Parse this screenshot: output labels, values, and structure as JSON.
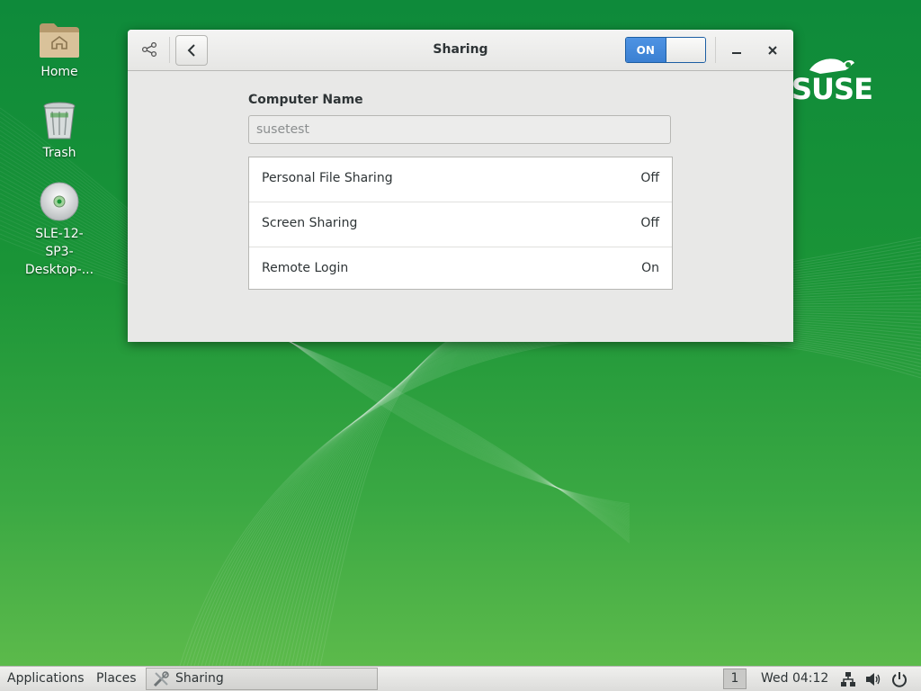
{
  "desktop": {
    "brand": "SUSE",
    "icons": [
      {
        "label": "Home",
        "icon": "home-folder-icon"
      },
      {
        "label": "Trash",
        "icon": "trash-icon"
      },
      {
        "label": "SLE-12-SP3-Desktop-...",
        "label_lines": [
          "SLE-12-",
          "SP3-",
          "Desktop-..."
        ],
        "icon": "optical-disc-icon"
      }
    ]
  },
  "window": {
    "title": "Sharing",
    "master_switch": "ON",
    "header_icon": "share-icon",
    "back_icon": "chevron-left-icon",
    "minimize_icon": "minimize-icon",
    "close_icon": "close-icon",
    "computer_name_label": "Computer Name",
    "computer_name_value": "susetest",
    "services": [
      {
        "name": "Personal File Sharing",
        "status": "Off"
      },
      {
        "name": "Screen Sharing",
        "status": "Off"
      },
      {
        "name": "Remote Login",
        "status": "On"
      }
    ]
  },
  "taskbar": {
    "applications": "Applications",
    "places": "Places",
    "task": {
      "label": "Sharing",
      "icon": "settings-tools-icon"
    },
    "workspace": "1",
    "clock": "Wed 04:12",
    "tray": [
      "network-icon",
      "volume-icon",
      "power-icon"
    ]
  },
  "colors": {
    "accent": "#3b80d2",
    "desktop_green": "#1a9437"
  }
}
